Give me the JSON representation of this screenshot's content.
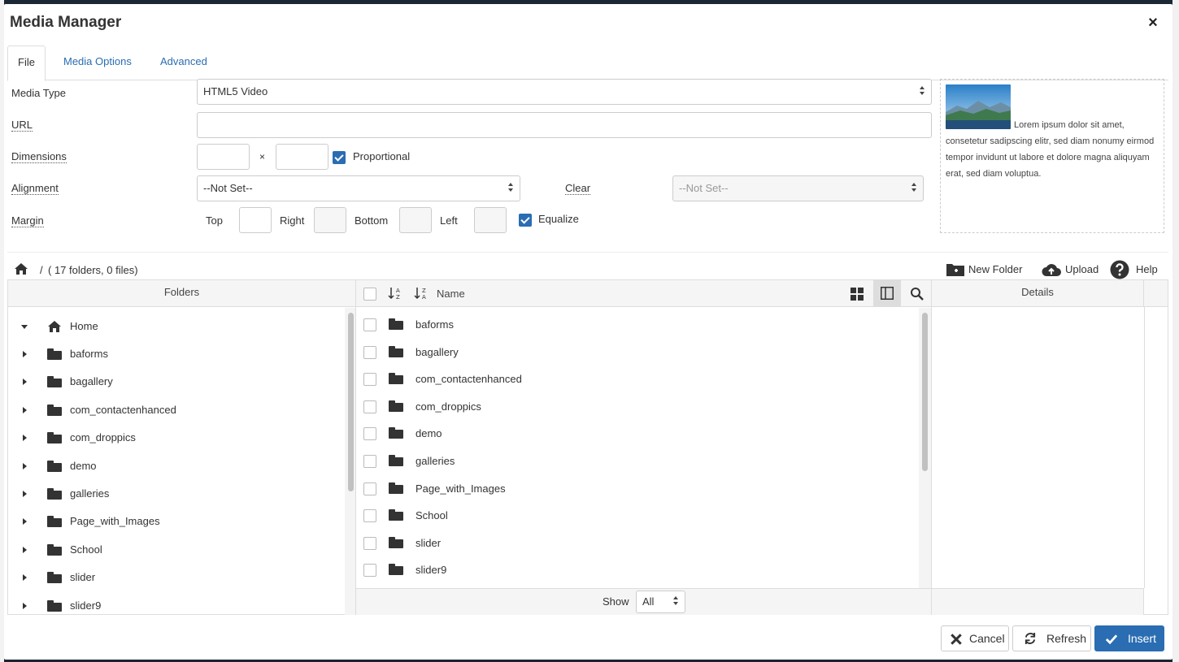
{
  "modal": {
    "title": "Media Manager",
    "close_symbol": "×"
  },
  "tabs": [
    {
      "label": "File",
      "active": true
    },
    {
      "label": "Media Options",
      "active": false
    },
    {
      "label": "Advanced",
      "active": false
    }
  ],
  "form": {
    "media_type_label": "Media Type",
    "media_type_value": "HTML5 Video",
    "url_label": "URL",
    "url_value": "",
    "dimensions_label": "Dimensions",
    "dimensions_separator": "×",
    "width_value": "",
    "height_value": "",
    "proportional_label": "Proportional",
    "proportional_checked": true,
    "alignment_label": "Alignment",
    "alignment_value": "--Not Set--",
    "clear_label": "Clear",
    "clear_value": "--Not Set--",
    "margin_label": "Margin",
    "margin_top_label": "Top",
    "margin_right_label": "Right",
    "margin_bottom_label": "Bottom",
    "margin_left_label": "Left",
    "equalize_label": "Equalize",
    "equalize_checked": true
  },
  "preview": {
    "image_icon": "landscape-thumbnail",
    "text": "Lorem ipsum dolor sit amet, consetetur sadipscing elitr, sed diam nonumy eirmod tempor invidunt ut labore et dolore magna aliquyam erat, sed diam voluptua."
  },
  "browser": {
    "path_separator": "/",
    "summary": "( 17 folders, 0 files)",
    "new_folder_label": "New Folder",
    "upload_label": "Upload",
    "help_label": "Help",
    "folders_header": "Folders",
    "name_header": "Name",
    "details_header": "Details",
    "show_label": "Show",
    "show_value": "All"
  },
  "tree": {
    "root": "Home",
    "folders": [
      "baforms",
      "bagallery",
      "com_contactenhanced",
      "com_droppics",
      "demo",
      "galleries",
      "Page_with_Images",
      "School",
      "slider",
      "slider9"
    ]
  },
  "list": {
    "folders": [
      "baforms",
      "bagallery",
      "com_contactenhanced",
      "com_droppics",
      "demo",
      "galleries",
      "Page_with_Images",
      "School",
      "slider",
      "slider9"
    ]
  },
  "footer": {
    "cancel_label": "Cancel",
    "refresh_label": "Refresh",
    "insert_label": "Insert"
  },
  "colors": {
    "accent": "#2a6db2",
    "header_bg": "#f5f5f5"
  }
}
